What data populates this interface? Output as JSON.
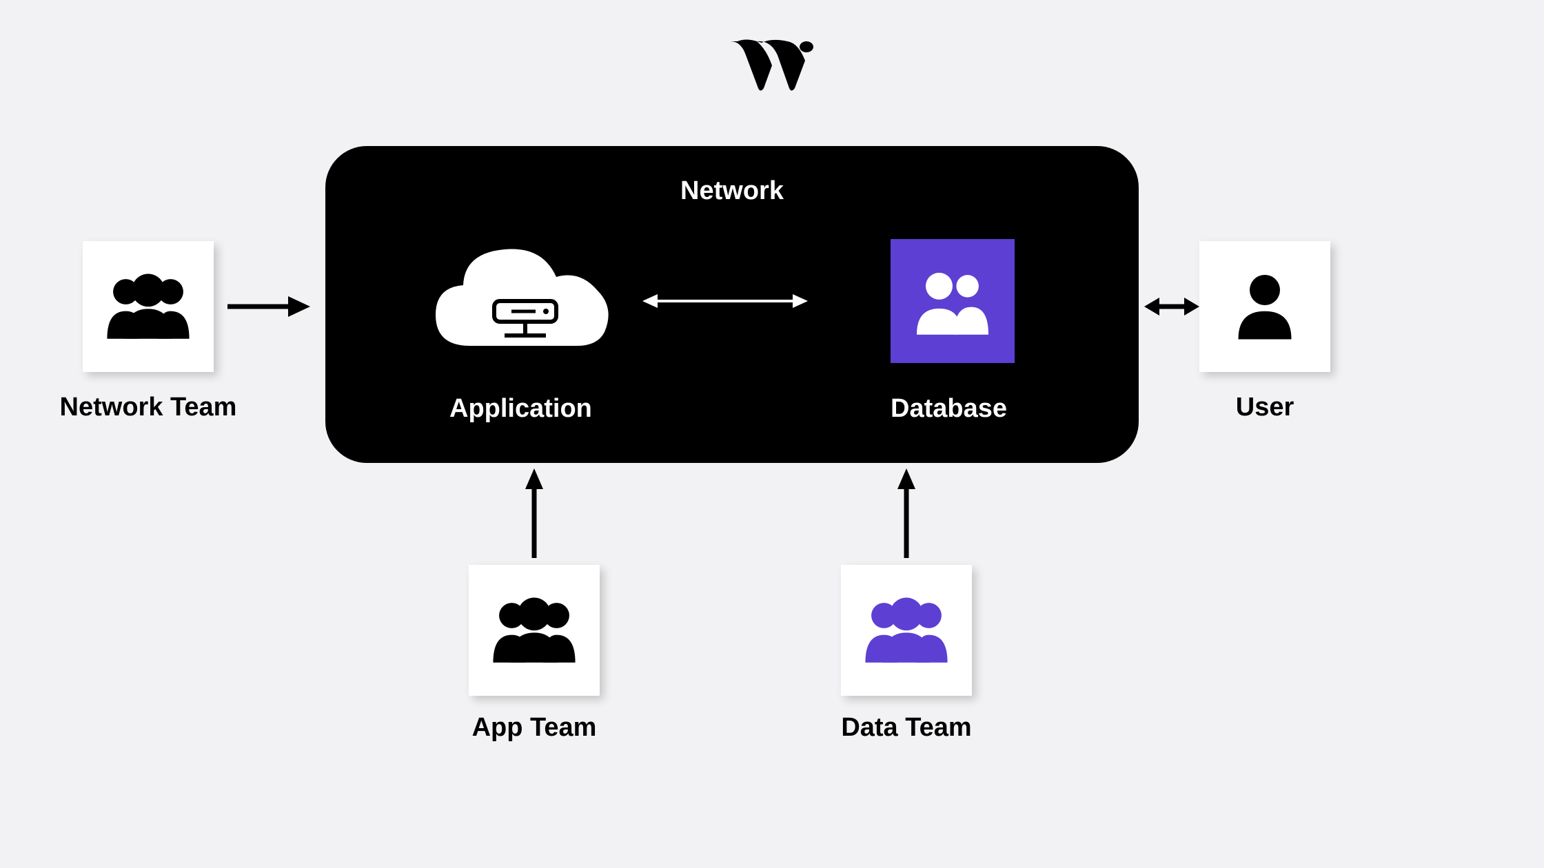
{
  "logo": "brand-w-logo",
  "network": {
    "title": "Network",
    "application_label": "Application",
    "database_label": "Database"
  },
  "teams": {
    "network_team": "Network Team",
    "app_team": "App Team",
    "data_team": "Data Team",
    "user": "User"
  },
  "colors": {
    "accent_purple": "#5d3fd3",
    "background": "#f2f2f4"
  }
}
